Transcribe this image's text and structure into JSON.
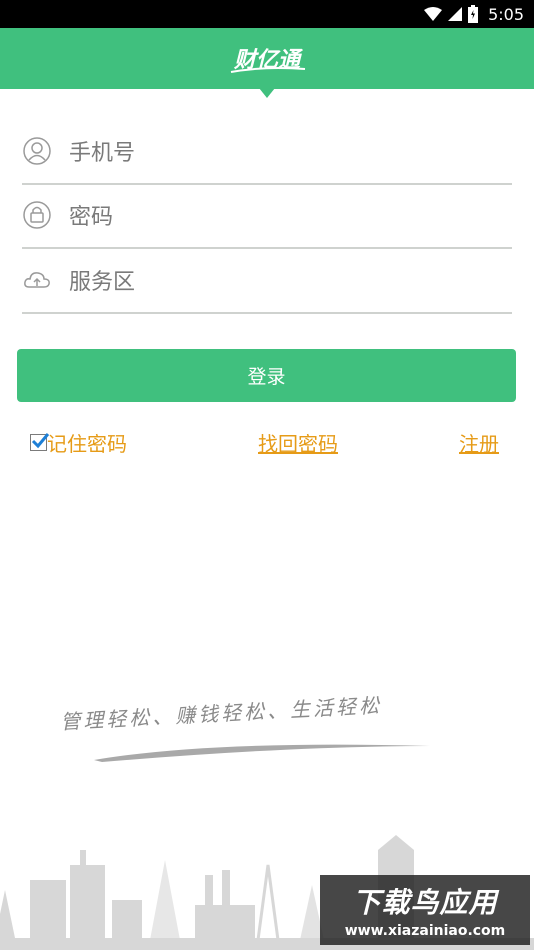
{
  "status_bar": {
    "time": "5:05",
    "icons": [
      "wifi-icon",
      "cellular-signal-icon",
      "battery-icon"
    ]
  },
  "header": {
    "logo_text": "财亿通",
    "background_color": "#40c07e"
  },
  "form": {
    "phone": {
      "placeholder": "手机号",
      "icon": "user-icon"
    },
    "password": {
      "placeholder": "密码",
      "icon": "lock-icon"
    },
    "service_area": {
      "placeholder": "服务区",
      "icon": "cloud-icon"
    },
    "login_label": "登录"
  },
  "options": {
    "remember_label": "记住密码",
    "remember_checked": true,
    "find_password_label": "找回密码",
    "register_label": "注册",
    "link_color": "#e69b17"
  },
  "slogan": "管理轻松、赚钱轻松、生活轻松",
  "watermark": {
    "title": "下载鸟应用",
    "url": "www.xiazainiao.com"
  }
}
